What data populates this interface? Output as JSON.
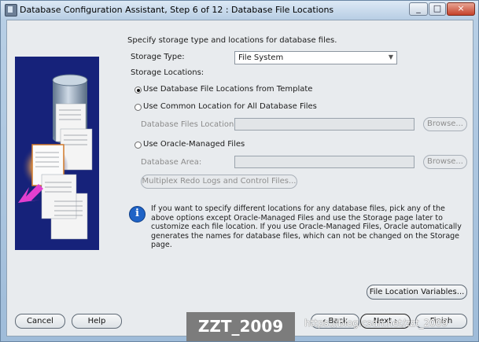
{
  "window": {
    "title": "Database Configuration Assistant, Step 6 of 12 : Database File Locations",
    "controls": [
      "_",
      "□",
      "×"
    ]
  },
  "main": {
    "intro": "Specify storage type and locations for database files.",
    "storage_type_label": "Storage Type:",
    "storage_type_value": "File System",
    "storage_locations_label": "Storage Locations:",
    "options": {
      "template": "Use Database File Locations from Template",
      "common": "Use Common Location for All Database Files",
      "files_location_label": "Database Files Location:",
      "files_location_value": "",
      "browse1": "Browse...",
      "omf": "Use Oracle-Managed Files",
      "area_label": "Database Area:",
      "area_value": "",
      "browse2": "Browse...",
      "multiplex": "Multiplex Redo Logs and Control Files..."
    },
    "info_text": "If you want to specify different locations for any database files, pick any of the above options except Oracle-Managed Files and use the Storage page later to customize each file location. If you use Oracle-Managed Files, Oracle automatically generates the names for database files, which can not be changed on the Storage page.",
    "file_location_variables": "File Location Variables..."
  },
  "footer": {
    "cancel": "Cancel",
    "help": "Help",
    "back": "Back",
    "next": "Next",
    "finish": "Finish"
  },
  "watermark": {
    "text": "ZZT_2009",
    "url": "https://blog.csdn.net/zzt_2009"
  },
  "colors": {
    "graphic_bg": "#16227a",
    "info_icon": "#1f63c6",
    "arrow": "#e23fcf"
  }
}
